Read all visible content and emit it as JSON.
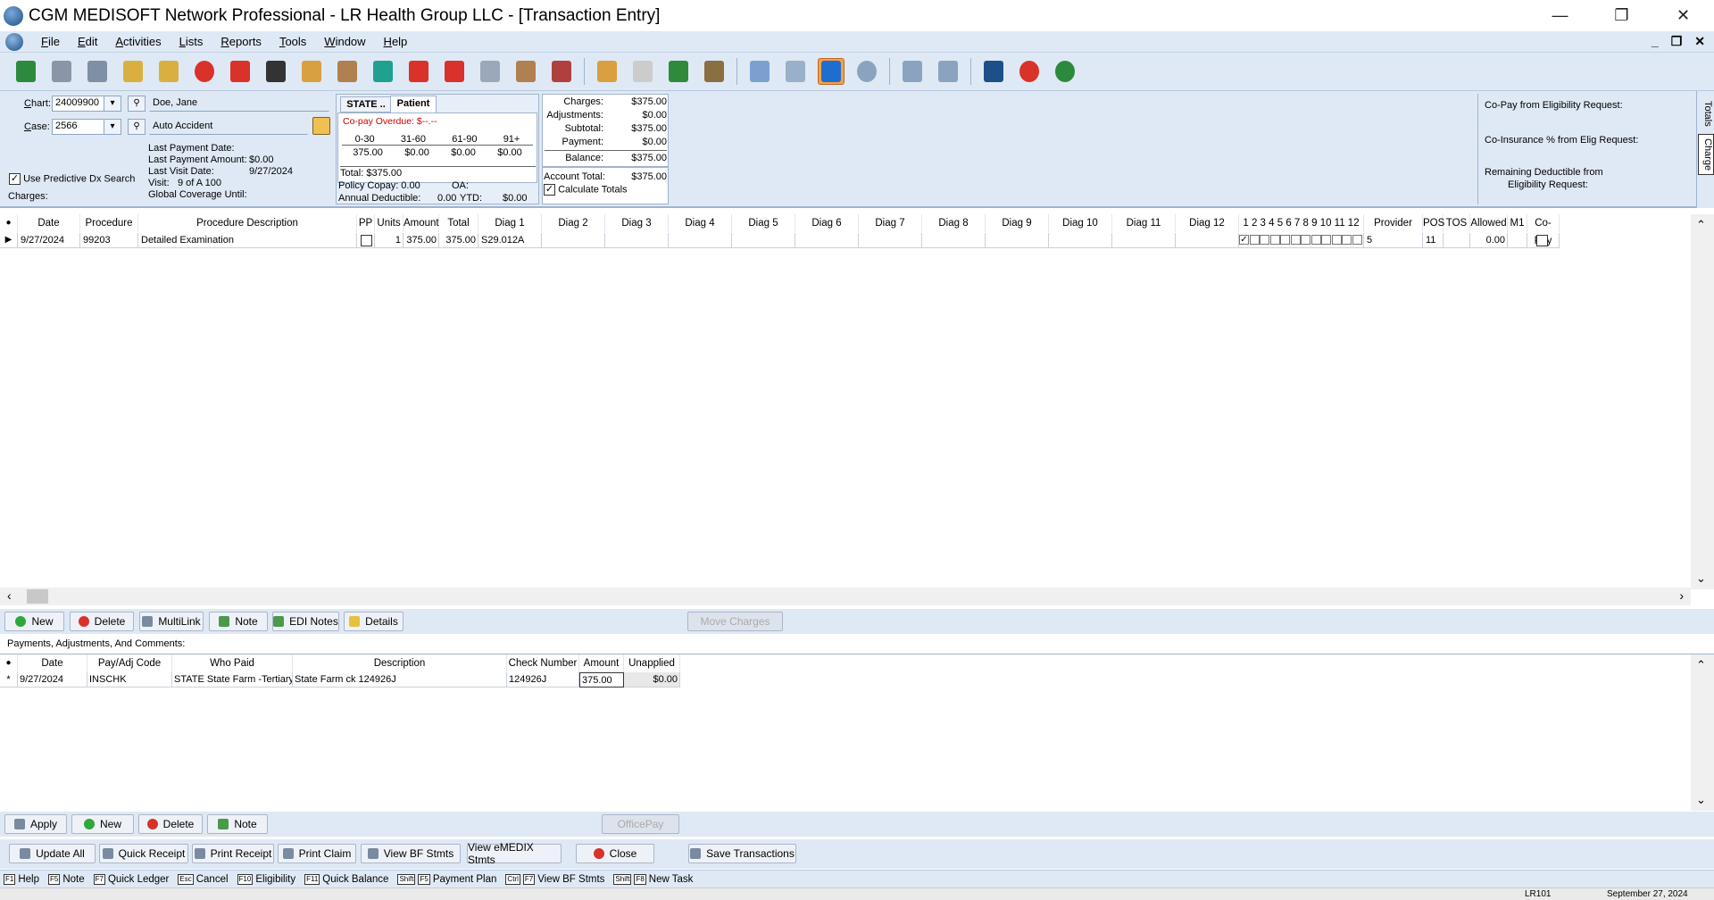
{
  "window": {
    "title": "CGM MEDISOFT Network Professional - LR Health Group LLC - [Transaction Entry]",
    "min": "—",
    "max": "❐",
    "close": "✕"
  },
  "menu": [
    "File",
    "Edit",
    "Activities",
    "Lists",
    "Reports",
    "Tools",
    "Window",
    "Help"
  ],
  "mdi": {
    "min": "_",
    "restore": "❐",
    "close": "✕"
  },
  "toolbar_icons": [
    "transaction-entry-icon",
    "claim-manager-icon",
    "statement-manager-icon",
    "collection-list-icon",
    "add-collection-icon",
    "appointment-book-icon",
    "calendar-icon",
    "traffic-light-icon",
    "patient-quick-entry-icon",
    "patients-icon",
    "insurance-card-icon",
    "procedure-codes-icon",
    "diagnosis-codes-icon",
    "provider-icon",
    "referring-provider-icon",
    "billing-charges-icon",
    "patient-list-icon",
    "attorney-icon",
    "money-icon",
    "deposit-icon",
    "moneybag-icon",
    "grid-view-icon",
    "computer-icon",
    "help-icon",
    "reports-icon",
    "document-icon",
    "clipboard-icon",
    "cgm-icon",
    "exit-icon"
  ],
  "chart": {
    "label": "Chart:",
    "value": "24009900",
    "name": "Doe, Jane"
  },
  "case": {
    "label": "Case:",
    "value": "2566",
    "desc": "Auto Accident"
  },
  "last_payment_date_label": "Last Payment Date:",
  "last_payment_amount_label": "Last Payment Amount:",
  "last_payment_amount": "$0.00",
  "last_visit_label": "Last Visit Date:",
  "last_visit": "9/27/2024",
  "visit_label": "Visit:",
  "visit": "9   of  A 100",
  "global_coverage_label": "Global Coverage Until:",
  "predictive": "Use Predictive Dx Search",
  "charges_label": "Charges:",
  "tabs": {
    "state": "STATE ..",
    "patient": "Patient"
  },
  "copay_overdue": "Co-pay Overdue: $--.--",
  "aging": {
    "headers": [
      "0-30",
      "31-60",
      "61-90",
      "91+"
    ],
    "values": [
      "375.00",
      "$0.00",
      "$0.00",
      "$0.00"
    ],
    "total": "Total: $375.00"
  },
  "policy_copay": "Policy Copay: 0.00",
  "oa": "OA:",
  "annual_deductible": "Annual Deductible:",
  "annual_val": "0.00",
  "ytd_label": "YTD:",
  "ytd_val": "$0.00",
  "totals": {
    "charges_l": "Charges:",
    "charges": "$375.00",
    "adj_l": "Adjustments:",
    "adj": "$0.00",
    "sub_l": "Subtotal:",
    "sub": "$375.00",
    "pay_l": "Payment:",
    "pay": "$0.00",
    "bal_l": "Balance:",
    "bal": "$375.00",
    "acct_l": "Account Total:",
    "acct": "$375.00",
    "calc": "Calculate Totals"
  },
  "elig": {
    "copay": "Co-Pay from Eligibility Request:",
    "coins": "Co-Insurance % from Elig Request:",
    "ded1": "Remaining Deductible from",
    "ded2": "Eligibility Request:"
  },
  "side_tabs": {
    "totals": "Totals",
    "charge": "Charge"
  },
  "charge_headers": [
    "Date",
    "Procedure",
    "Procedure Description",
    "PP",
    "Units",
    "Amount",
    "Total",
    "Diag 1",
    "Diag 2",
    "Diag 3",
    "Diag 4",
    "Diag 5",
    "Diag 6",
    "Diag 7",
    "Diag 8",
    "Diag 9",
    "Diag 10",
    "Diag 11",
    "Diag 12",
    "1 2 3 4 5 6 7 8 9 10 11 12",
    "Provider",
    "POS",
    "TOS",
    "Allowed",
    "M1",
    "Co-Pay"
  ],
  "charge_row": {
    "date": "9/27/2024",
    "procedure": "99203",
    "desc": "Detailed Examination",
    "units": "1",
    "amount": "375.00",
    "total": "375.00",
    "diag1": "S29.012A",
    "provider": "5",
    "pos": "11",
    "allowed": "0.00"
  },
  "charge_buttons": {
    "new": "New",
    "delete": "Delete",
    "multilink": "MultiLink",
    "note": "Note",
    "edi": "EDI Notes",
    "details": "Details",
    "move": "Move Charges"
  },
  "payments_label": "Payments, Adjustments, And Comments:",
  "pay_headers": [
    "Date",
    "Pay/Adj Code",
    "Who Paid",
    "Description",
    "Check Number",
    "Amount",
    "Unapplied"
  ],
  "pay_row": {
    "date": "9/27/2024",
    "code": "INSCHK",
    "who": "STATE State Farm -Tertiary",
    "desc": "State Farm ck 124926J",
    "check": "124926J",
    "amount": "375.00",
    "unapplied": "$0.00"
  },
  "pay_buttons": {
    "apply": "Apply",
    "new": "New",
    "delete": "Delete",
    "note": "Note",
    "officepay": "OfficePay"
  },
  "bottom_buttons": {
    "update": "Update All",
    "quick": "Quick Receipt",
    "print": "Print Receipt",
    "claim": "Print Claim",
    "bf": "View BF Stmts",
    "emedix": "View eMEDIX Stmts",
    "close": "Close",
    "save": "Save Transactions"
  },
  "fkeys": [
    {
      "k": "F1",
      "t": "Help"
    },
    {
      "k": "F5",
      "t": "Note"
    },
    {
      "k": "F7",
      "t": "Quick Ledger"
    },
    {
      "k": "Esc",
      "t": "Cancel"
    },
    {
      "k": "F10",
      "t": "Eligibility"
    },
    {
      "k": "F11",
      "t": "Quick Balance"
    },
    {
      "k": "Shift F5",
      "t": "Payment Plan"
    },
    {
      "k": "Ctrl F7",
      "t": "View BF Stmts"
    },
    {
      "k": "Shift F8",
      "t": "New Task"
    }
  ],
  "status": {
    "user": "LR101",
    "date": "September 27, 2024"
  }
}
